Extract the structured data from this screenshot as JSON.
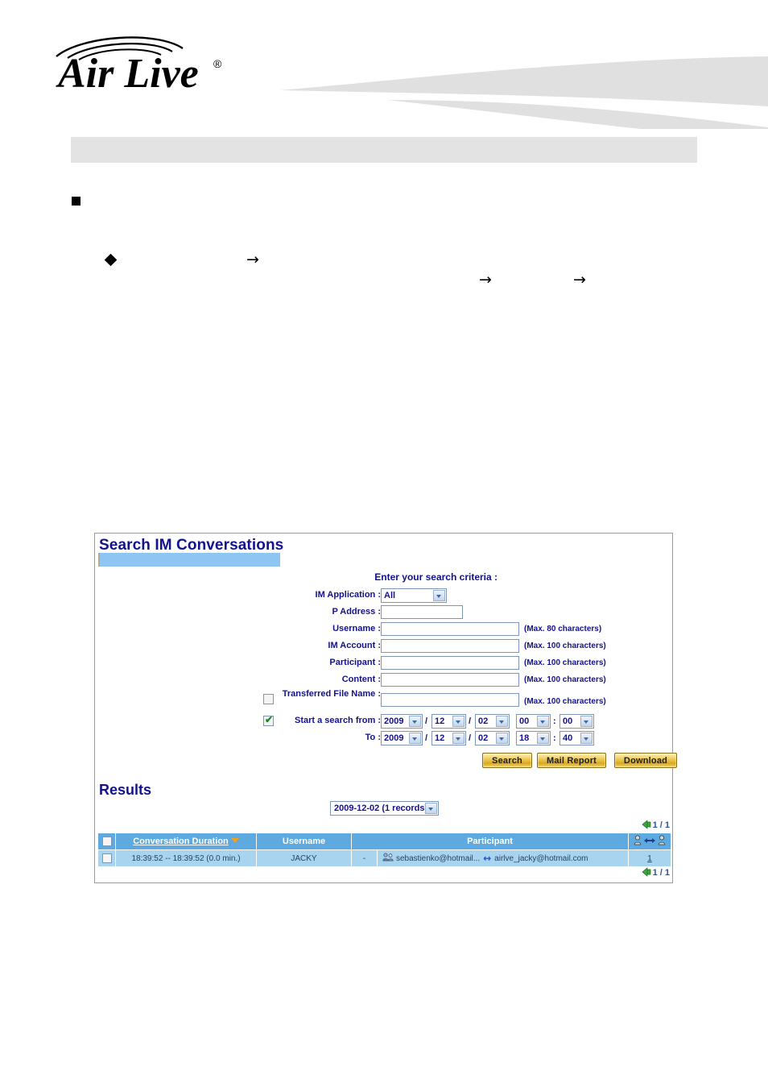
{
  "banner": {
    "logo_text": "Air Live",
    "logo_trademark": "®",
    "logo_icon": "wifi-waves-icon",
    "swoosh_icon": "banner-swoosh-graphic"
  },
  "title_bar": {
    "text": ""
  },
  "outline": {
    "square_bullet": "■",
    "diamond_bullet": "◆",
    "arrow": "→"
  },
  "panel": {
    "title": "Search IM Conversations",
    "criteria_heading": "Enter your search criteria :",
    "fields": [
      {
        "label": "IM Application :",
        "type": "select",
        "value": "All",
        "hint": ""
      },
      {
        "label": "P Address :",
        "type": "text",
        "value": "",
        "hint": ""
      },
      {
        "label": "Username :",
        "type": "text",
        "value": "",
        "hint": "(Max. 80 characters)"
      },
      {
        "label": "IM Account :",
        "type": "text",
        "value": "",
        "hint": "(Max. 100 characters)"
      },
      {
        "label": "Participant :",
        "type": "text",
        "value": "",
        "hint": "(Max. 100 characters)"
      },
      {
        "label": "Content :",
        "type": "text",
        "value": "",
        "hint": "(Max. 100 characters)"
      },
      {
        "label": "Transferred File Name :",
        "type": "text",
        "value": "",
        "hint": "(Max. 100 characters)",
        "checkbox": false
      }
    ],
    "date_rows": [
      {
        "label": "Start a search from :",
        "checkbox": true,
        "year": "2009",
        "month": "12",
        "day": "02",
        "hour": "00",
        "minute": "00"
      },
      {
        "label": "To :",
        "checkbox": null,
        "year": "2009",
        "month": "12",
        "day": "02",
        "hour": "18",
        "minute": "40"
      }
    ],
    "date_sep1": "/",
    "date_sep2": "/",
    "time_sep": ":",
    "buttons": [
      {
        "label": "Search",
        "name": "search-button"
      },
      {
        "label": "Mail Report",
        "name": "mail-report-button"
      },
      {
        "label": "Download",
        "name": "download-button"
      }
    ]
  },
  "results": {
    "title": "Results",
    "records_select": "2009-12-02 (1 records)",
    "pager_top": "1 / 1",
    "pager_bottom": "1 / 1",
    "columns": [
      "Conversation Duration",
      "Username",
      "Participant",
      "participants-count-icon"
    ],
    "rows": [
      {
        "duration": "18:39:52 -- 18:39:52 (0.0 min.)",
        "username": "JACKY",
        "ip": "-",
        "participant_from": "sebastienko@hotmail...",
        "participant_arrow": "↔",
        "participant_to": "airlve_jacky@hotmail.com",
        "count": "1"
      }
    ]
  },
  "colors": {
    "title_blue": "#13128c",
    "table_header": "#5da9e0",
    "table_row": "#a8d4f0",
    "accent_bar": "#8dc6f0",
    "grey_bar": "#e3e3e3",
    "button_gold": "#e8be3c",
    "check_green": "#108a10",
    "sort_orange": "#f0a020"
  }
}
